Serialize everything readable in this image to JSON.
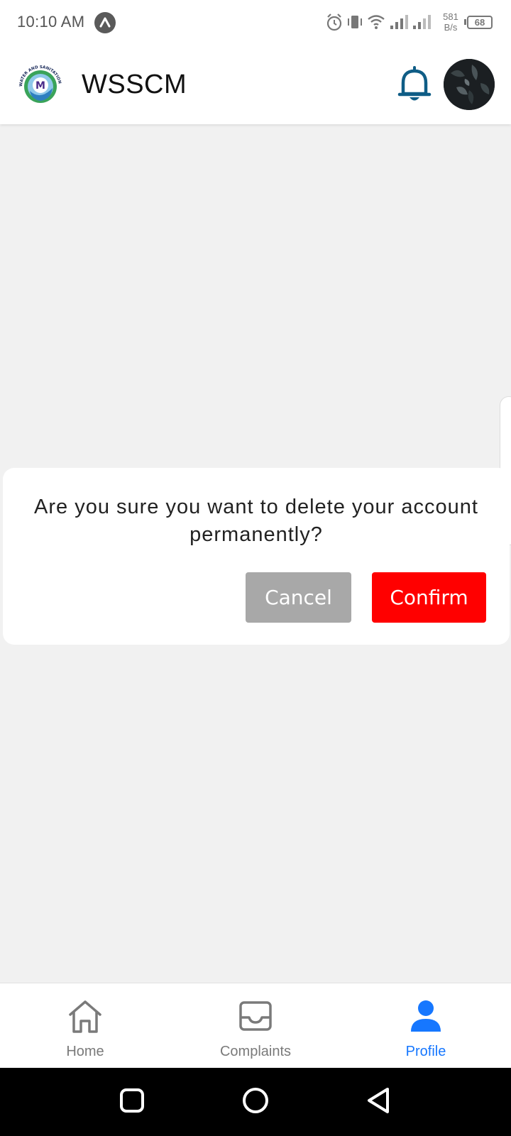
{
  "status_bar": {
    "time": "10:10 AM",
    "net_speed_value": "581",
    "net_speed_unit": "B/s",
    "battery": "68",
    "icons": [
      "app-notification-icon",
      "alarm-icon",
      "vibrate-icon",
      "wifi-icon",
      "signal-icon",
      "signal-icon"
    ]
  },
  "header": {
    "title": "WSSCM",
    "logo": "wsscm-logo",
    "logo_text": "WATER AND SANITATION SERVICES COMPANY MARDAN",
    "logo_monogram": "M",
    "notification_icon": "bell-icon",
    "avatar": "profile-avatar"
  },
  "dialog": {
    "message": "Are you sure you want to delete your account permanently?",
    "cancel_label": "Cancel",
    "confirm_label": "Confirm"
  },
  "bottom_nav": {
    "items": [
      {
        "label": "Home",
        "icon": "home-icon",
        "active": false
      },
      {
        "label": "Complaints",
        "icon": "inbox-icon",
        "active": false
      },
      {
        "label": "Profile",
        "icon": "user-icon",
        "active": true
      }
    ]
  },
  "system_nav": [
    "recents-icon",
    "home-circle-icon",
    "back-icon"
  ],
  "colors": {
    "accent": "#1677ff",
    "danger": "#ff0000",
    "cancel_gray": "#a8a8a8",
    "background": "#f1f1f1",
    "bell": "#0f5d86"
  }
}
